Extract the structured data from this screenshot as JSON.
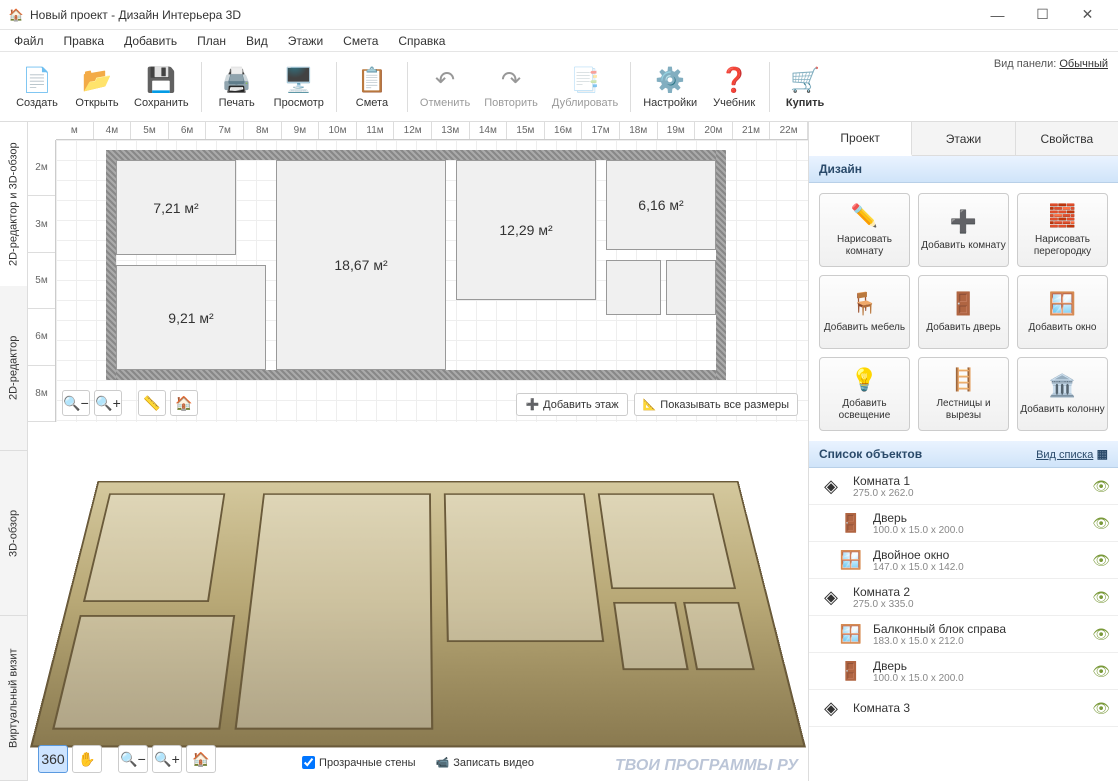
{
  "window": {
    "title": "Новый проект - Дизайн Интерьера 3D"
  },
  "menu": [
    "Файл",
    "Правка",
    "Добавить",
    "План",
    "Вид",
    "Этажи",
    "Смета",
    "Справка"
  ],
  "toolbar": {
    "create": "Создать",
    "open": "Открыть",
    "save": "Сохранить",
    "print": "Печать",
    "preview": "Просмотр",
    "estimate": "Смета",
    "undo": "Отменить",
    "redo": "Повторить",
    "duplicate": "Дублировать",
    "settings": "Настройки",
    "tutorial": "Учебник",
    "buy": "Купить",
    "panel_label": "Вид панели:",
    "panel_mode": "Обычный"
  },
  "vtabs": [
    "2D-редактор и 3D-обзор",
    "2D-редактор",
    "3D-обзор",
    "Виртуальный визит"
  ],
  "ruler_h": [
    "м",
    "4м",
    "5м",
    "6м",
    "7м",
    "8м",
    "9м",
    "10м",
    "11м",
    "12м",
    "13м",
    "14м",
    "15м",
    "16м",
    "17м",
    "18м",
    "19м",
    "20м",
    "21м",
    "22м"
  ],
  "ruler_v": [
    "2м",
    "3м",
    "5м",
    "6м",
    "8м"
  ],
  "rooms": {
    "r1": "7,21 м²",
    "r2": "18,67 м²",
    "r3": "12,29 м²",
    "r4": "6,16 м²",
    "r5": "9,21 м²"
  },
  "plan_actions": {
    "add_floor": "Добавить этаж",
    "show_all_dims": "Показывать все размеры"
  },
  "view3d": {
    "transparent_walls": "Прозрачные стены",
    "record_video": "Записать видео"
  },
  "rtabs": [
    "Проект",
    "Этажи",
    "Свойства"
  ],
  "design_hdr": "Дизайн",
  "design_buttons": [
    "Нарисовать комнату",
    "Добавить комнату",
    "Нарисовать перегородку",
    "Добавить мебель",
    "Добавить дверь",
    "Добавить окно",
    "Добавить освещение",
    "Лестницы и вырезы",
    "Добавить колонну"
  ],
  "objects_hdr": "Список объектов",
  "objects_view": "Вид списка",
  "objects": [
    {
      "name": "Комната 1",
      "dim": "275.0 x 262.0",
      "icon": "room"
    },
    {
      "name": "Дверь",
      "dim": "100.0 x 15.0 x 200.0",
      "icon": "door",
      "indent": true
    },
    {
      "name": "Двойное окно",
      "dim": "147.0 x 15.0 x 142.0",
      "icon": "window",
      "indent": true
    },
    {
      "name": "Комната 2",
      "dim": "275.0 x 335.0",
      "icon": "room"
    },
    {
      "name": "Балконный блок справа",
      "dim": "183.0 x 15.0 x 212.0",
      "icon": "window",
      "indent": true
    },
    {
      "name": "Дверь",
      "dim": "100.0 x 15.0 x 200.0",
      "icon": "door",
      "indent": true
    },
    {
      "name": "Комната 3",
      "dim": "",
      "icon": "room"
    }
  ],
  "watermark": "ТВОИ ПРОГРАММЫ РУ"
}
